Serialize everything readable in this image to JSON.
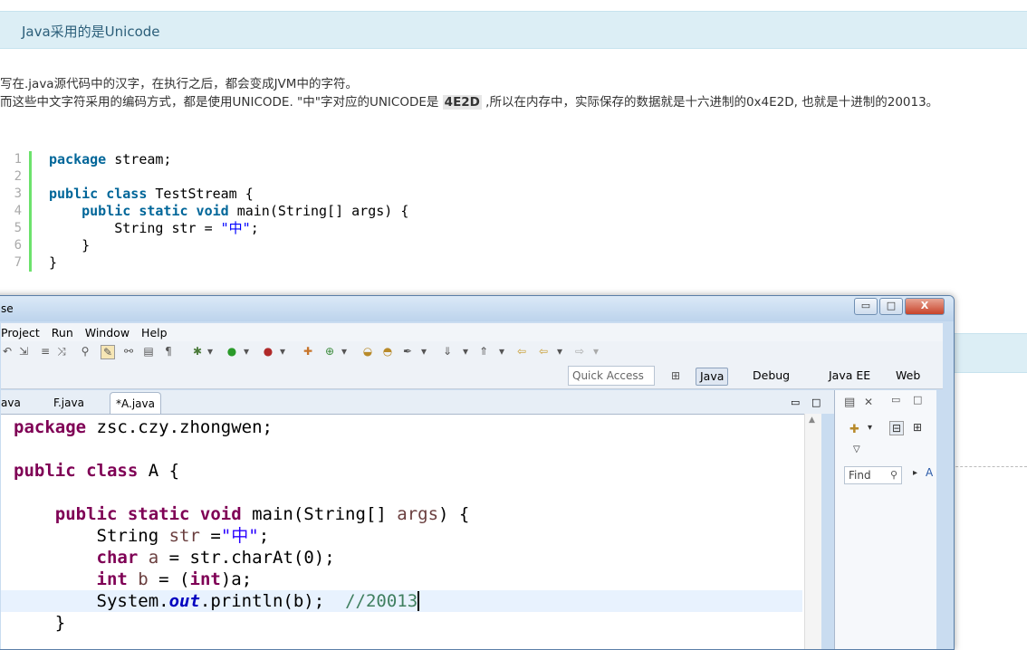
{
  "article": {
    "section_title": "Java采用的是Unicode",
    "line1": "写在.java源代码中的汉字，在执行之后，都会变成JVM中的字符。",
    "line2_before": "而这些中文字符采用的编码方式，都是使用UNICODE. \"中\"字对应的UNICODE是 ",
    "line2_highlight": "4E2D",
    "line2_after": " ,所以在内存中，实际保存的数据就是十六进制的0x4E2D, 也就是十进制的20013。"
  },
  "snippet": {
    "line_numbers": [
      "1",
      "2",
      "3",
      "4",
      "5",
      "6",
      "7"
    ],
    "l1_kw": "package",
    "l1_rest": " stream;",
    "l3_kw": "public class",
    "l3_rest": " TestStream {",
    "l4_indent": "    ",
    "l4_kw": "public static void",
    "l4_rest": " main(String[] args) {",
    "l5_pre": "        String str = ",
    "l5_str": "\"中\"",
    "l5_post": ";",
    "l6": "    }",
    "l7": "}"
  },
  "eclipse": {
    "title_fragment": "se",
    "window_buttons": {
      "minimize": "▭",
      "maximize": "□",
      "close": "X"
    },
    "menu": [
      "Project",
      "Run",
      "Window",
      "Help"
    ],
    "quick_access_placeholder": "Quick Access",
    "perspectives": [
      "Java",
      "Debug",
      "Java EE",
      "Web"
    ],
    "tabs": [
      "ava",
      "F.java",
      "*A.java"
    ],
    "editor": {
      "l1_kw": "package",
      "l1_rest": " zsc.czy.zhongwen;",
      "l2_kw": "public class",
      "l2_rest": " A {",
      "l3_indent": "    ",
      "l3_kw": "public static void",
      "l3_mid": " main(String[] ",
      "l3_var": "args",
      "l3_end": ") {",
      "l4_pre": "        String ",
      "l4_var": "str",
      "l4_mid": " =",
      "l4_str": "\"中\"",
      "l4_end": ";",
      "l5_indent": "        ",
      "l5_kw": "char",
      "l5_var": " a",
      "l5_rest": " = str.charAt(0);",
      "l6_indent": "        ",
      "l6_kw": "int",
      "l6_var": " b",
      "l6_mid": " = (",
      "l6_kw2": "int",
      "l6_rest": ")a;",
      "l7_pre": "        System.",
      "l7_field": "out",
      "l7_mid": ".println(b);  ",
      "l7_comment": "//20013",
      "l8": "    }"
    },
    "outline_find_placeholder": "Find",
    "outline_label": "A"
  }
}
